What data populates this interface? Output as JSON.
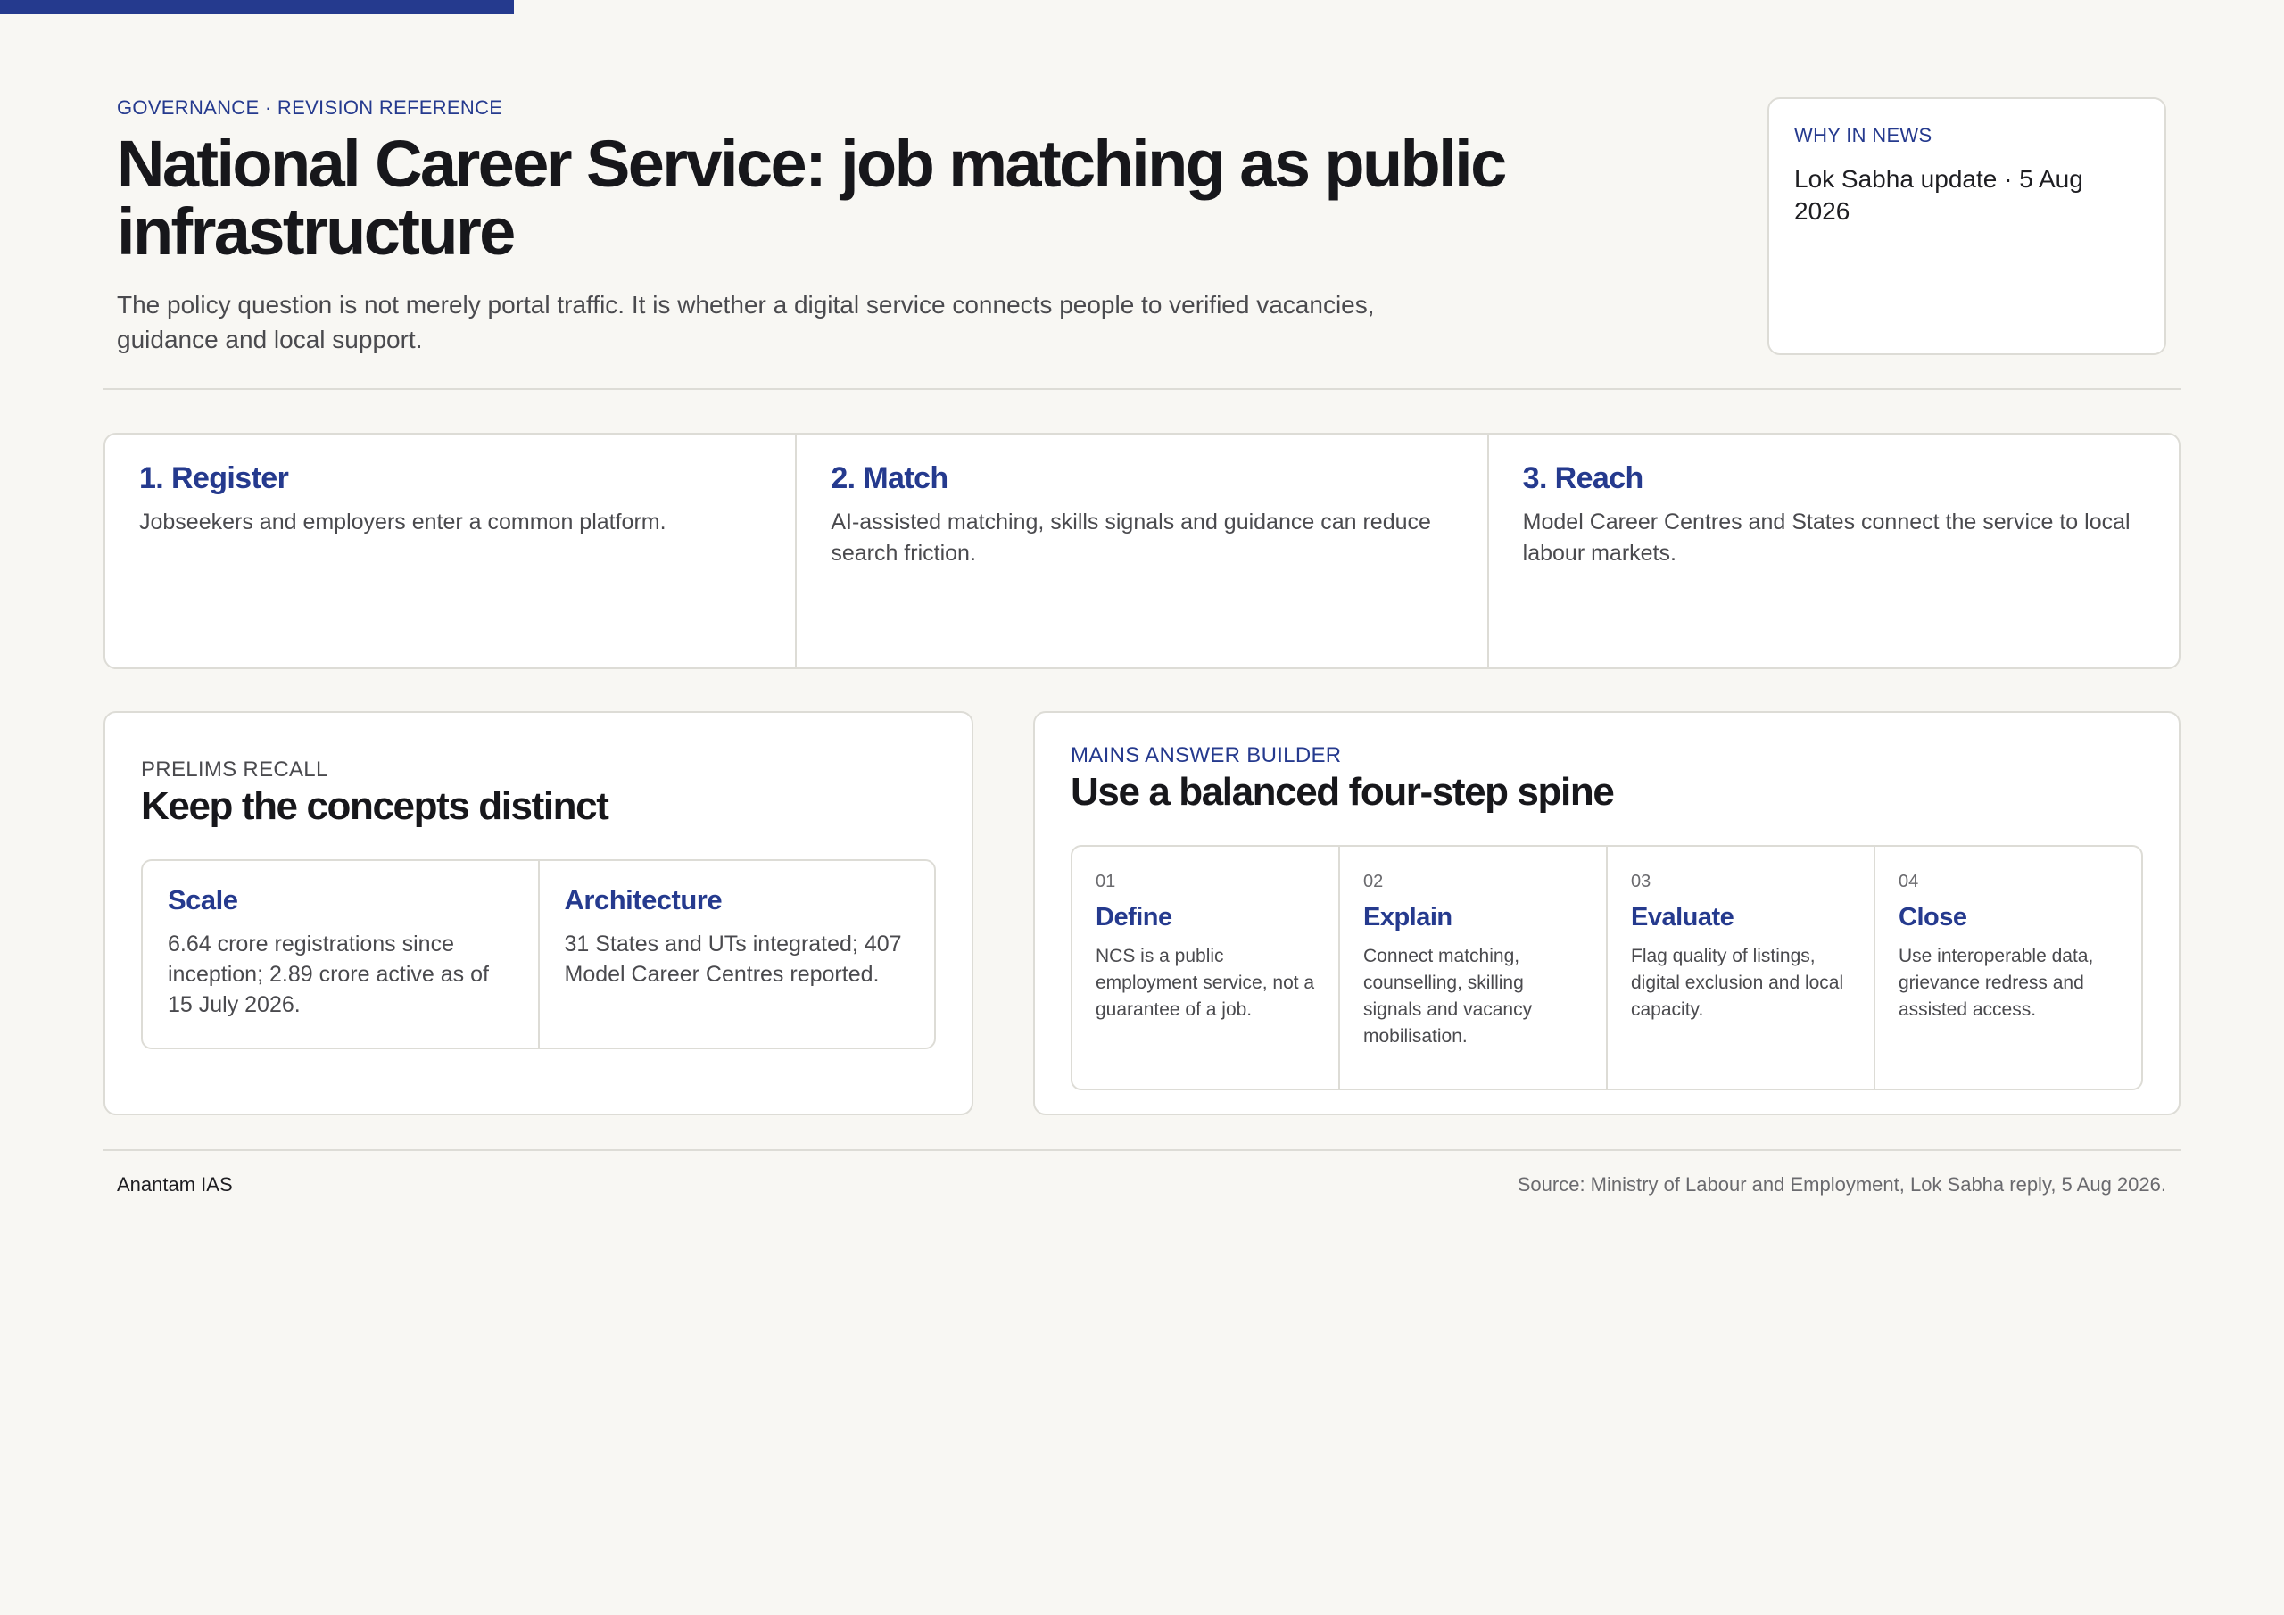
{
  "header": {
    "kicker": "GOVERNANCE · REVISION REFERENCE",
    "title": "National Career Service: job matching as public infrastructure",
    "lede": "The policy question is not merely portal traffic. It is whether a digital service connects people to verified vacancies, guidance and local support."
  },
  "news": {
    "kicker": "WHY IN NEWS",
    "text": "Lok Sabha update · 5 Aug 2026"
  },
  "steps": [
    {
      "title": "1. Register",
      "text": "Jobseekers and employers enter a common platform."
    },
    {
      "title": "2. Match",
      "text": "AI-assisted matching, skills signals and guidance can reduce search friction."
    },
    {
      "title": "3. Reach",
      "text": "Model Career Centres and States connect the service to local labour markets."
    }
  ],
  "prelims": {
    "kicker": "PRELIMS RECALL",
    "title": "Keep the concepts distinct",
    "concepts": [
      {
        "title": "Scale",
        "text": "6.64 crore registrations since inception; 2.89 crore active as of 15 July 2026."
      },
      {
        "title": "Architecture",
        "text": "31 States and UTs integrated; 407 Model Career Centres reported."
      }
    ]
  },
  "mains": {
    "kicker": "MAINS ANSWER BUILDER",
    "title": "Use a balanced four-step spine",
    "steps": [
      {
        "num": "01",
        "title": "Define",
        "text": "NCS is a public employment service, not a guarantee of a job."
      },
      {
        "num": "02",
        "title": "Explain",
        "text": "Connect matching, counselling, skilling signals and vacancy mobilisation."
      },
      {
        "num": "03",
        "title": "Evaluate",
        "text": "Flag quality of listings, digital exclusion and local capacity."
      },
      {
        "num": "04",
        "title": "Close",
        "text": "Use interoperable data, grievance redress and assisted access."
      }
    ]
  },
  "footer": {
    "brand": "Anantam IAS",
    "source": "Source: Ministry of Labour and Employment, Lok Sabha reply, 5 Aug 2026."
  },
  "colors": {
    "accent": "#253a8e",
    "background": "#f8f7f3",
    "border": "#dddcd6"
  }
}
